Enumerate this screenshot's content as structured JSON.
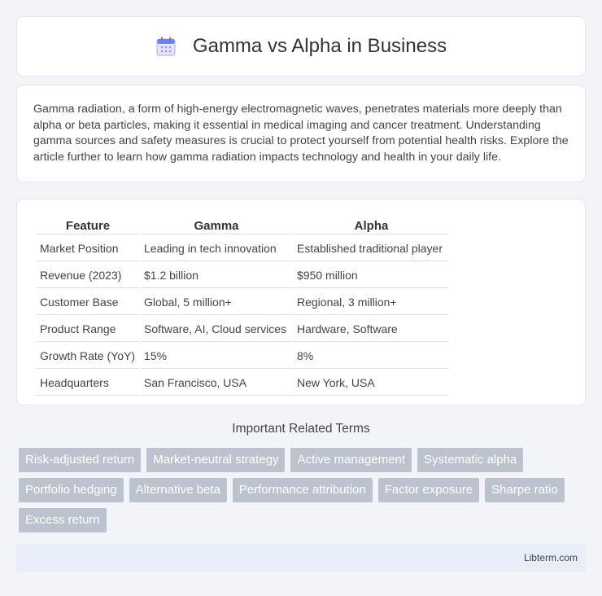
{
  "header": {
    "title": "Gamma vs Alpha in Business",
    "icon": "calendar-icon"
  },
  "intro": {
    "text": "Gamma radiation, a form of high-energy electromagnetic waves, penetrates materials more deeply than alpha or beta particles, making it essential in medical imaging and cancer treatment. Understanding gamma sources and safety measures is crucial to protect yourself from potential health risks. Explore the article further to learn how gamma radiation impacts technology and health in your daily life."
  },
  "table": {
    "headers": [
      "Feature",
      "Gamma",
      "Alpha"
    ],
    "rows": [
      [
        "Market Position",
        "Leading in tech innovation",
        "Established traditional player"
      ],
      [
        "Revenue (2023)",
        "$1.2 billion",
        "$950 million"
      ],
      [
        "Customer Base",
        "Global, 5 million+",
        "Regional, 3 million+"
      ],
      [
        "Product Range",
        "Software, AI, Cloud services",
        "Hardware, Software"
      ],
      [
        "Growth Rate (YoY)",
        "15%",
        "8%"
      ],
      [
        "Headquarters",
        "San Francisco, USA",
        "New York, USA"
      ]
    ]
  },
  "related": {
    "title": "Important Related Terms",
    "tags": [
      "Risk-adjusted return",
      "Market-neutral strategy",
      "Active management",
      "Systematic alpha",
      "Portfolio hedging",
      "Alternative beta",
      "Performance attribution",
      "Factor exposure",
      "Sharpe ratio",
      "Excess return"
    ]
  },
  "footer": {
    "text": "Libterm.com"
  }
}
